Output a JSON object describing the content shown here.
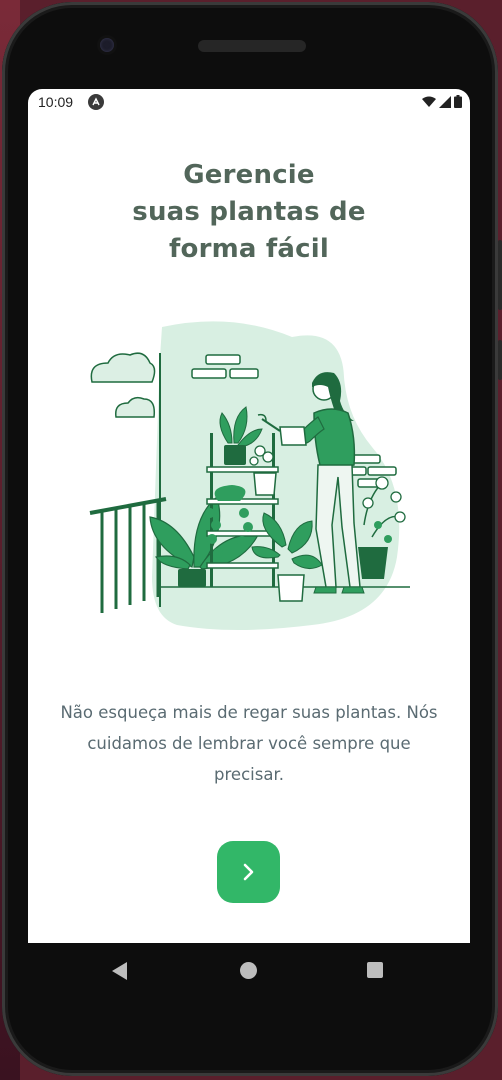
{
  "status_bar": {
    "time": "10:09",
    "app_icon": "android-studio-icon",
    "wifi_icon": "wifi-icon",
    "signal_icon": "cell-signal-icon",
    "battery_icon": "battery-icon"
  },
  "welcome": {
    "title_lines": [
      "Gerencie",
      "suas plantas de",
      "forma fácil"
    ],
    "illustration": "woman-watering-plants-illustration",
    "description": "Não esqueça mais de regar suas plantas. Nós cuidamos de lembrar você sempre que precisar.",
    "next_button_icon": "chevron-right-icon"
  },
  "nav_bar": {
    "back_icon": "back-triangle-icon",
    "home_icon": "home-circle-icon",
    "recents_icon": "recents-square-icon"
  },
  "colors": {
    "accent": "#32b768",
    "title": "#52665a",
    "body_text": "#5a6b72",
    "illustration_green": "#1f6b3f",
    "illustration_light": "#d8efe2"
  }
}
